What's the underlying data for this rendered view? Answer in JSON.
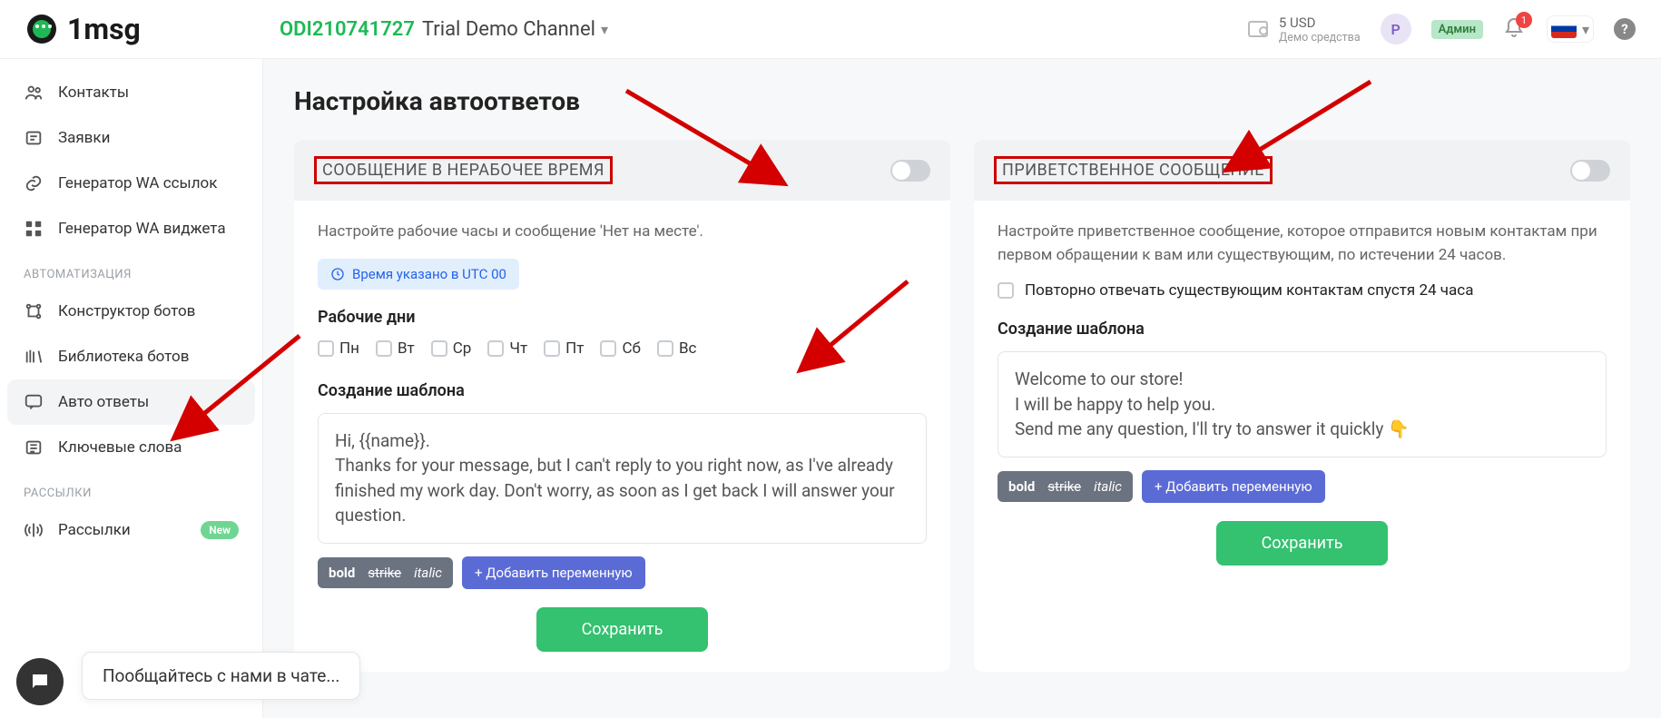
{
  "header": {
    "brand": "1msg",
    "channel_id": "ODI210741727",
    "channel_name": "Trial Demo Channel",
    "balance_amount": "5 USD",
    "balance_label": "Демо средства",
    "avatar_letter": "P",
    "role": "Админ",
    "notif_count": "1"
  },
  "nav": {
    "items": [
      {
        "label": "Контакты",
        "icon": "contacts"
      },
      {
        "label": "Заявки",
        "icon": "tickets"
      },
      {
        "label": "Генератор WA ссылок",
        "icon": "link"
      },
      {
        "label": "Генератор WA виджета",
        "icon": "widget"
      }
    ],
    "section_auto": "АВТОМАТИЗАЦИЯ",
    "auto": [
      {
        "label": "Конструктор ботов",
        "icon": "flow"
      },
      {
        "label": "Библиотека ботов",
        "icon": "library"
      },
      {
        "label": "Авто ответы",
        "icon": "chat",
        "active": true
      },
      {
        "label": "Ключевые слова",
        "icon": "keywords"
      }
    ],
    "section_mail": "РАССЫЛКИ",
    "mail": [
      {
        "label": "Рассылки",
        "icon": "broadcast",
        "badge": "New"
      }
    ]
  },
  "page": {
    "title": "Настройка автоответов"
  },
  "card1": {
    "title": "СООБЩЕНИЕ В НЕРАБОЧЕЕ ВРЕМЯ",
    "desc": "Настройте рабочие часы и сообщение 'Нет на месте'.",
    "utc": "Время указано в UTC 00",
    "workdays_label": "Рабочие дни",
    "days": [
      "Пн",
      "Вт",
      "Ср",
      "Чт",
      "Пт",
      "Сб",
      "Вс"
    ],
    "template_label": "Создание шаблона",
    "template_text": "Hi, {{name}}.\nThanks for your message, but I can't reply to you right now, as I've already finished my work day. Don't worry, as soon as I get back I will answer your question.",
    "fmt": {
      "bold": "bold",
      "strike": "strike",
      "italic": "italic"
    },
    "add_var": "+ Добавить переменную",
    "save": "Сохранить"
  },
  "card2": {
    "title": "ПРИВЕТСТВЕННОЕ СООБЩЕНИЕ",
    "desc": "Настройте приветственное сообщение, которое отправится новым контактам при первом обращении к вам или существующим, по истечении 24 часов.",
    "repeat_label": "Повторно отвечать существующим контактам спустя 24 часа",
    "template_label": "Создание шаблона",
    "template_text": "Welcome to our store!\nI will be happy to help you.\nSend me any question, I'll try to answer it quickly 👇",
    "fmt": {
      "bold": "bold",
      "strike": "strike",
      "italic": "italic"
    },
    "add_var": "+ Добавить переменную",
    "save": "Сохранить"
  },
  "chat": {
    "prompt": "Пообщайтесь с нами в чате..."
  }
}
